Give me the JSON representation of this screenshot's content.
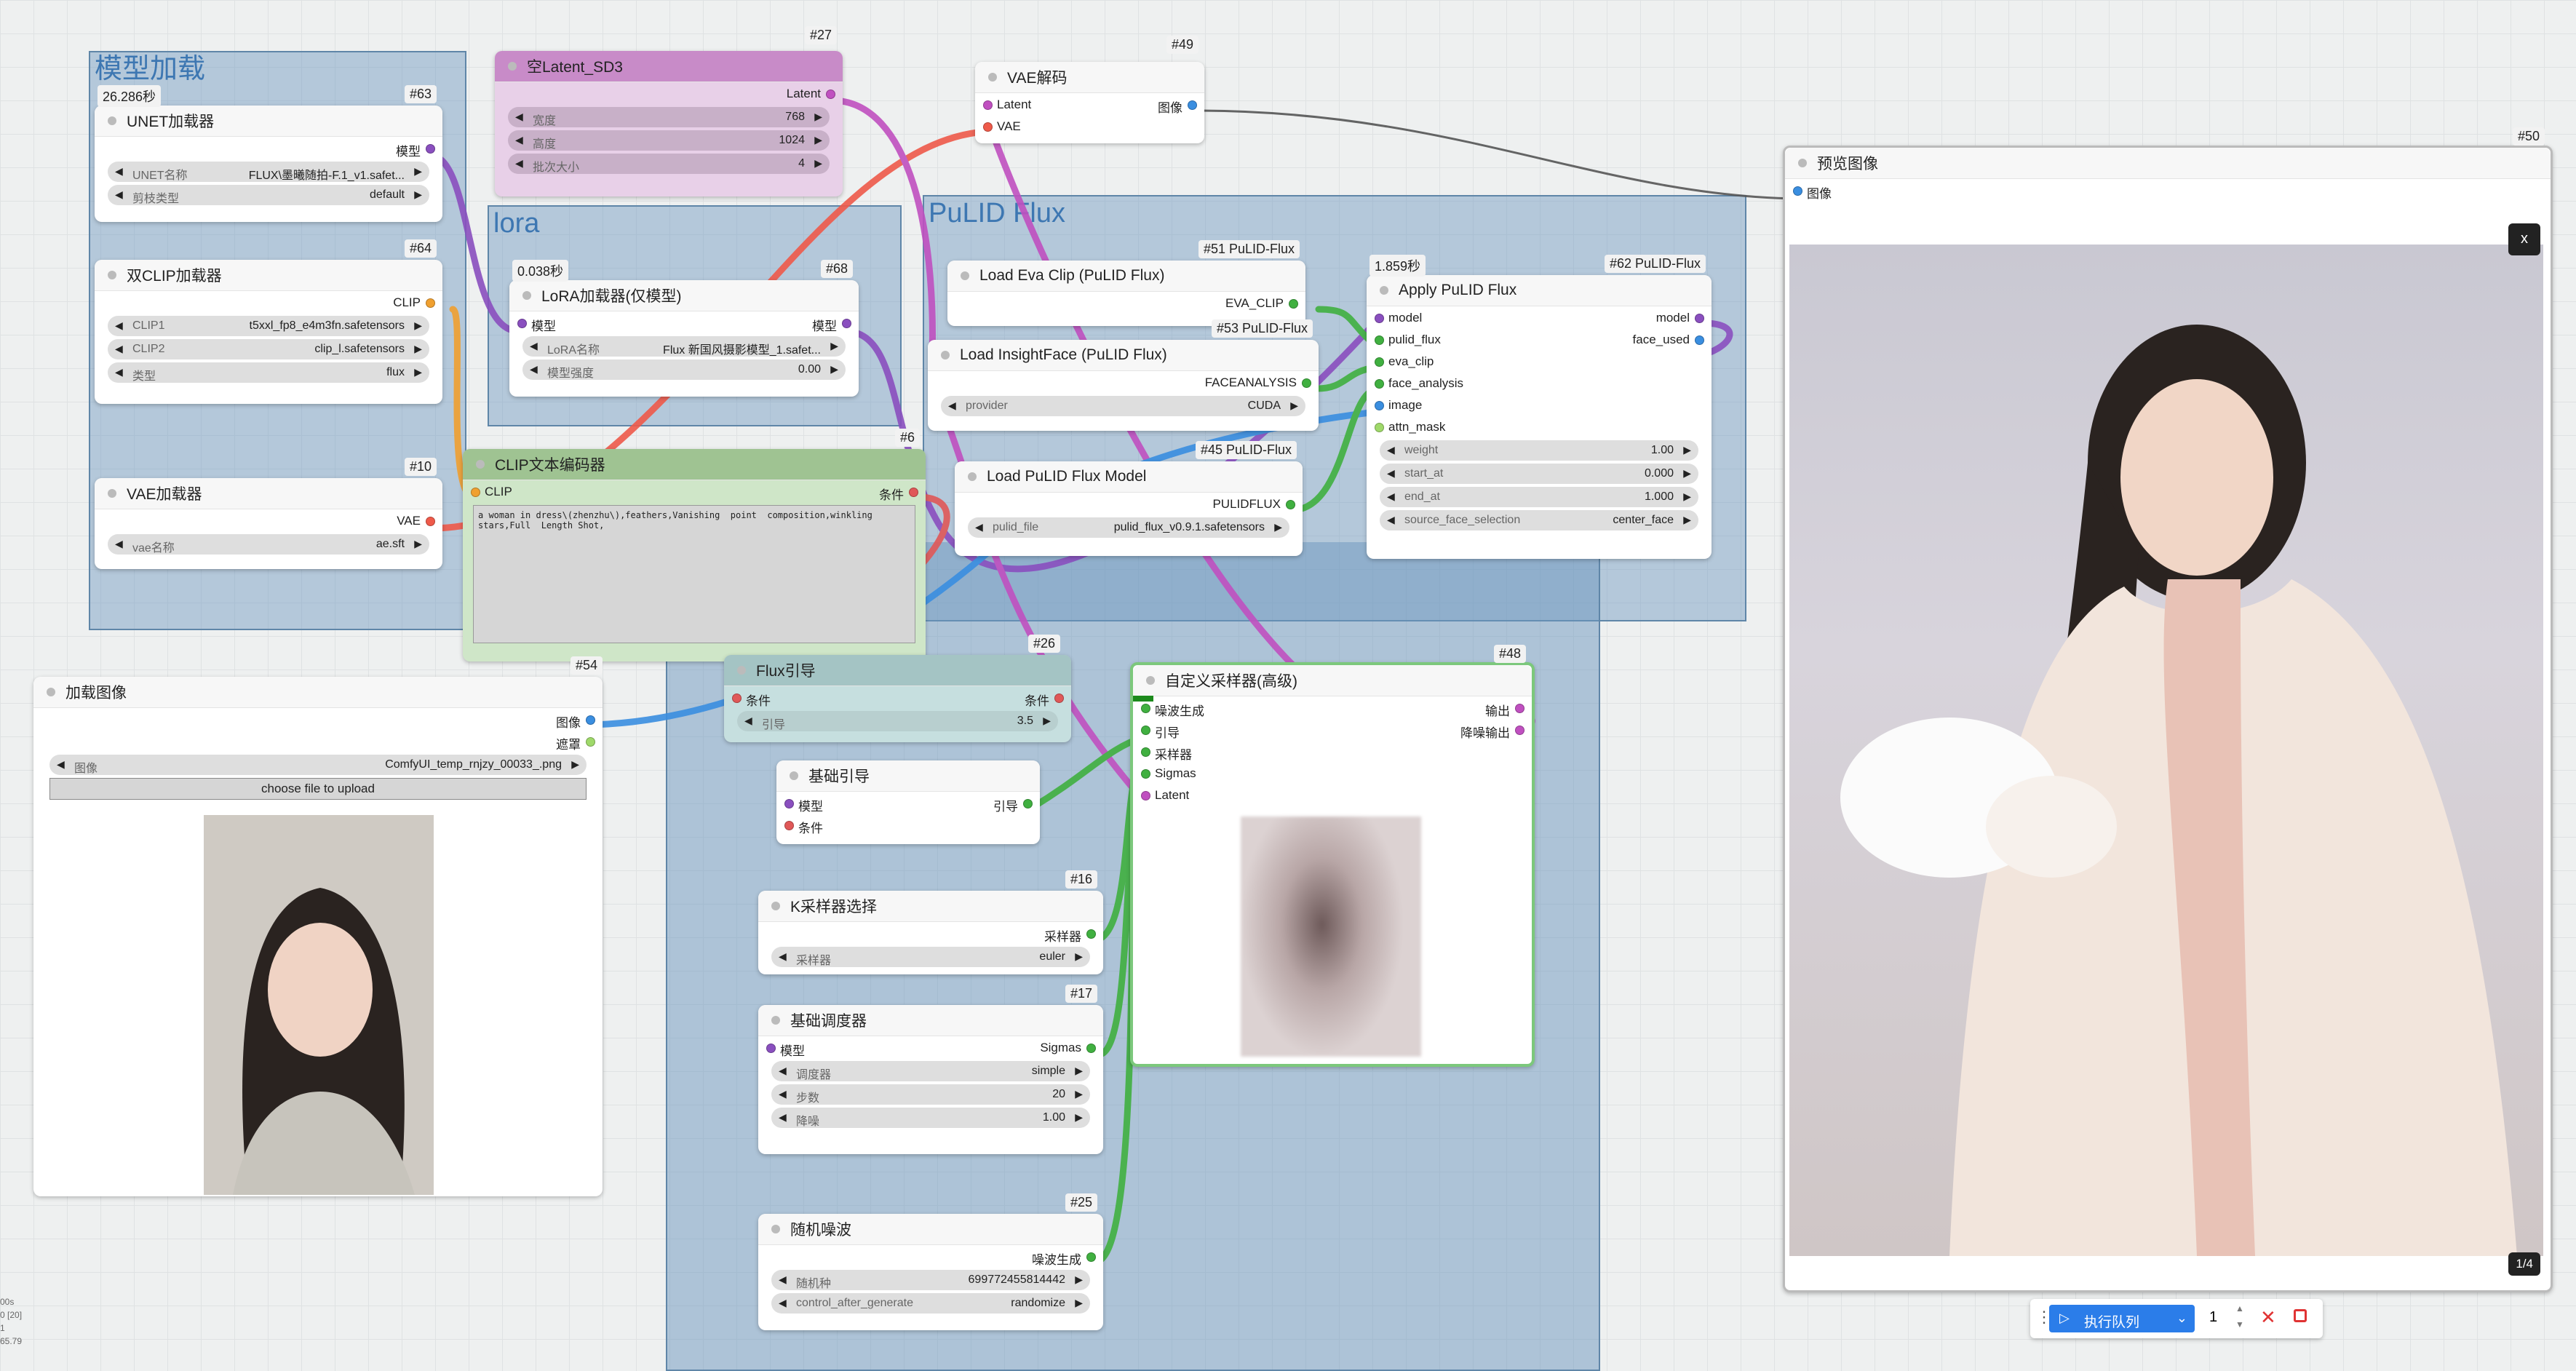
{
  "groups": {
    "model_load": "模型加载",
    "lora": "lora",
    "pulid": "PuLID Flux"
  },
  "nodes": {
    "unet": {
      "id": "#63",
      "time": "26.286秒",
      "title": "UNET加载器",
      "out": "模型",
      "w": [
        {
          "label": "UNET名称",
          "value": "FLUX\\墨曦随拍-F.1_v1.safet..."
        },
        {
          "label": "剪枝类型",
          "value": "default"
        }
      ]
    },
    "dualclip": {
      "id": "#64",
      "title": "双CLIP加载器",
      "out": "CLIP",
      "w": [
        {
          "label": "CLIP1",
          "value": "t5xxl_fp8_e4m3fn.safetensors"
        },
        {
          "label": "CLIP2",
          "value": "clip_l.safetensors"
        },
        {
          "label": "类型",
          "value": "flux"
        }
      ]
    },
    "vae": {
      "id": "#10",
      "title": "VAE加载器",
      "out": "VAE",
      "w": [
        {
          "label": "vae名称",
          "value": "ae.sft"
        }
      ]
    },
    "latent": {
      "id": "#27",
      "title": "空Latent_SD3",
      "out": "Latent",
      "w": [
        {
          "label": "宽度",
          "value": "768"
        },
        {
          "label": "高度",
          "value": "1024"
        },
        {
          "label": "批次大小",
          "value": "4"
        }
      ]
    },
    "lora": {
      "id": "#68",
      "time": "0.038秒",
      "title": "LoRA加载器(仅模型)",
      "in": "模型",
      "out": "模型",
      "w": [
        {
          "label": "LoRA名称",
          "value": "Flux 新国风摄影模型_1.safet..."
        },
        {
          "label": "模型强度",
          "value": "0.00"
        }
      ]
    },
    "clipenc": {
      "id": "#6",
      "title": "CLIP文本编码器",
      "in": "CLIP",
      "out": "条件",
      "text": "a woman in dress\\(zhenzhu\\),feathers,Vanishing  point  composition,winkling  stars,Full  Length Shot,"
    },
    "vaedec": {
      "id": "#49",
      "title": "VAE解码",
      "in1": "Latent",
      "in2": "VAE",
      "out": "图像"
    },
    "preview": {
      "id": "#50",
      "title": "预览图像",
      "in": "图像",
      "close": "x",
      "counter": "1/4"
    },
    "evaclip": {
      "id": "#51 PuLID-Flux",
      "title": "Load Eva Clip (PuLID Flux)",
      "out": "EVA_CLIP"
    },
    "insight": {
      "id": "#53 PuLID-Flux",
      "title": "Load InsightFace (PuLID Flux)",
      "out": "FACEANALYSIS",
      "w": [
        {
          "label": "provider",
          "value": "CUDA"
        }
      ]
    },
    "pulidmodel": {
      "id": "#45 PuLID-Flux",
      "title": "Load PuLID Flux Model",
      "out": "PULIDFLUX",
      "w": [
        {
          "label": "pulid_file",
          "value": "pulid_flux_v0.9.1.safetensors"
        }
      ]
    },
    "apply": {
      "id": "#62 PuLID-Flux",
      "time": "1.859秒",
      "title": "Apply PuLID Flux",
      "ins": [
        "model",
        "pulid_flux",
        "eva_clip",
        "face_analysis",
        "image",
        "attn_mask"
      ],
      "outs": [
        "model",
        "face_used"
      ],
      "w": [
        {
          "label": "weight",
          "value": "1.00"
        },
        {
          "label": "start_at",
          "value": "0.000"
        },
        {
          "label": "end_at",
          "value": "1.000"
        },
        {
          "label": "source_face_selection",
          "value": "center_face"
        }
      ]
    },
    "loadimg": {
      "id": "#54",
      "title": "加载图像",
      "out1": "图像",
      "out2": "遮罩",
      "w": [
        {
          "label": "图像",
          "value": "ComfyUI_temp_rnjzy_00033_.png"
        }
      ],
      "upload": "choose file to upload"
    },
    "guidance": {
      "id": "#26",
      "title": "Flux引导",
      "in": "条件",
      "out": "条件",
      "w": [
        {
          "label": "引导",
          "value": "3.5"
        }
      ]
    },
    "basicguider": {
      "title": "基础引导",
      "in1": "模型",
      "in2": "条件",
      "out": "引导"
    },
    "ksampler": {
      "id": "#16",
      "title": "K采样器选择",
      "out": "采样器",
      "w": [
        {
          "label": "采样器",
          "value": "euler"
        }
      ]
    },
    "scheduler": {
      "id": "#17",
      "title": "基础调度器",
      "in": "模型",
      "out": "Sigmas",
      "w": [
        {
          "label": "调度器",
          "value": "simple"
        },
        {
          "label": "步数",
          "value": "20"
        },
        {
          "label": "降噪",
          "value": "1.00"
        }
      ]
    },
    "noise": {
      "id": "#25",
      "title": "随机噪波",
      "out": "噪波生成",
      "w": [
        {
          "label": "随机种",
          "value": "699772455814442"
        },
        {
          "label": "control_after_generate",
          "value": "randomize"
        }
      ]
    },
    "sampler": {
      "id": "#48",
      "title": "自定义采样器(高级)",
      "ins": [
        "噪波生成",
        "引导",
        "采样器",
        "Sigmas",
        "Latent"
      ],
      "outs": [
        "输出",
        "降噪输出"
      ]
    }
  },
  "queue": {
    "run_label": "执行队列",
    "count": "1"
  },
  "stats": [
    "00s",
    "0 [20]",
    "1",
    "65.79"
  ],
  "colors": {
    "model": "#8a4fbf",
    "clip": "#f0a030",
    "vae": "#ef5a4a",
    "latent": "#c050c0",
    "image": "#3a8ee0",
    "cond": "#e05858",
    "green": "#40b040",
    "run": "#2b7de9"
  }
}
